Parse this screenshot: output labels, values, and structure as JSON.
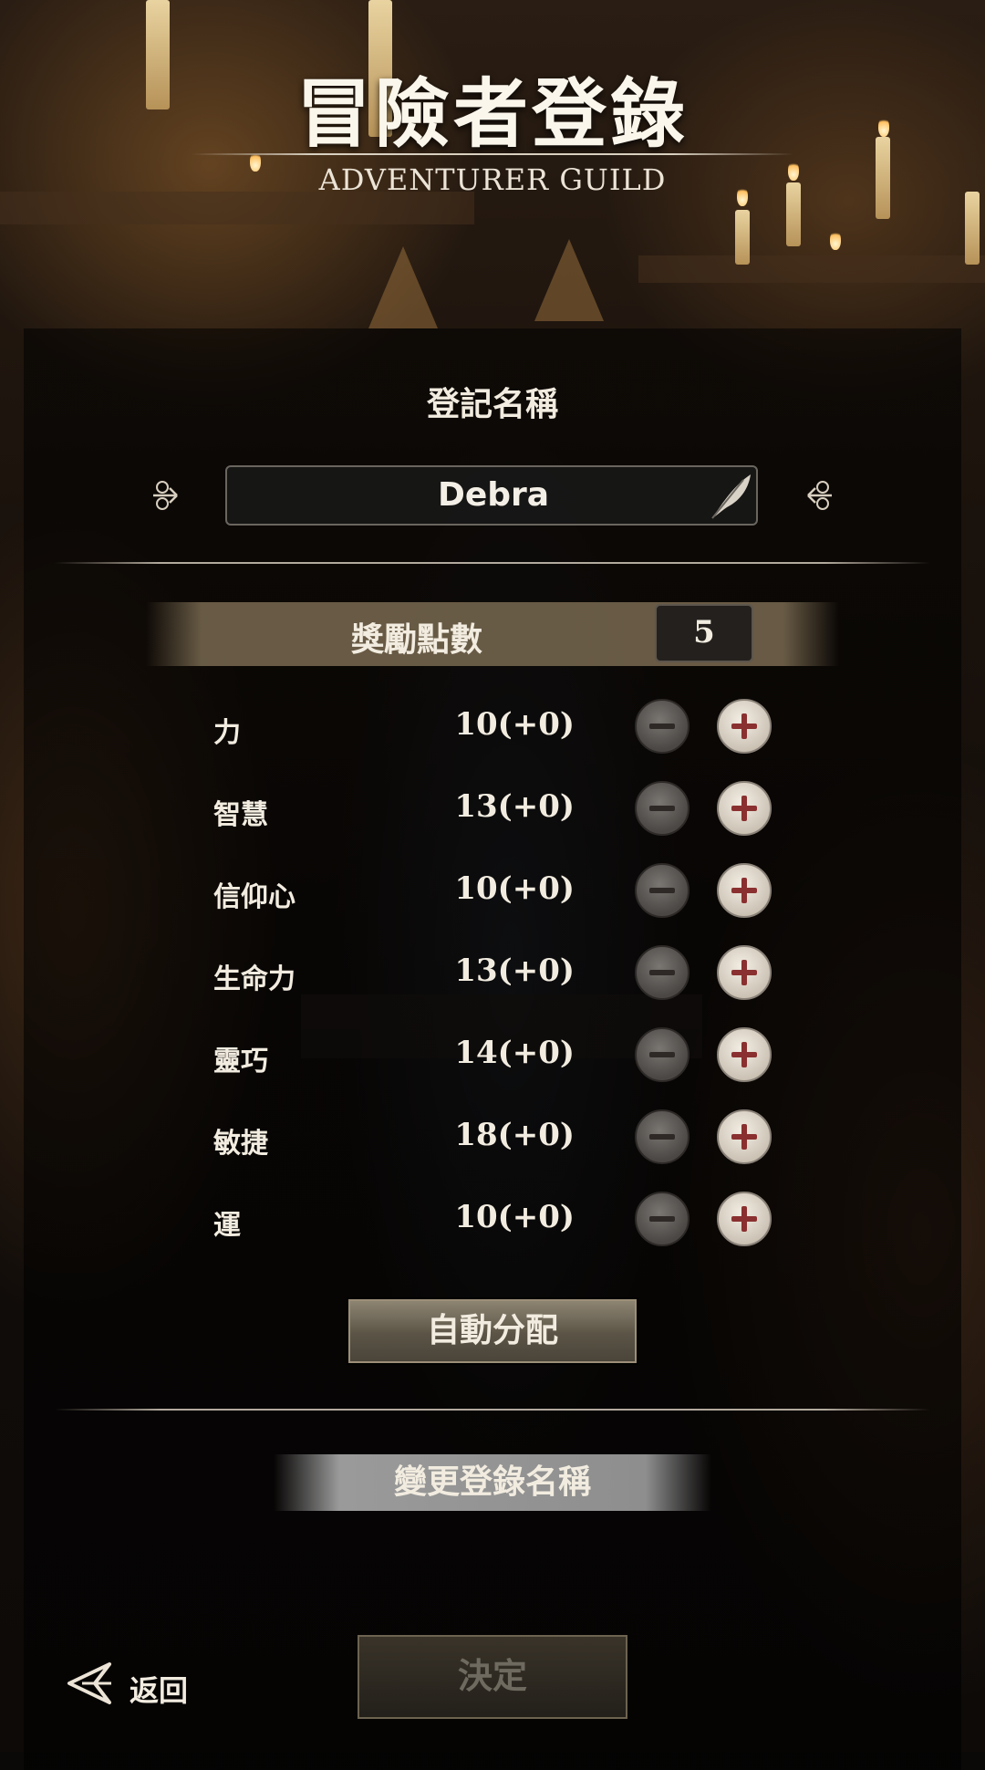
{
  "header": {
    "title": "冒險者登錄",
    "subtitle": "ADVENTURER GUILD"
  },
  "name_section": {
    "label": "登記名稱",
    "value": "Debra",
    "edit_icon": "quill-icon"
  },
  "bonus": {
    "label": "獎勵點數",
    "value": "5"
  },
  "stats": [
    {
      "name": "力",
      "value": "10(+0)"
    },
    {
      "name": "智慧",
      "value": "13(+0)"
    },
    {
      "name": "信仰心",
      "value": "10(+0)"
    },
    {
      "name": "生命力",
      "value": "13(+0)"
    },
    {
      "name": "靈巧",
      "value": "14(+0)"
    },
    {
      "name": "敏捷",
      "value": "18(+0)"
    },
    {
      "name": "運",
      "value": "10(+0)"
    }
  ],
  "buttons": {
    "auto_assign": "自動分配",
    "rename": "變更登錄名稱",
    "confirm": "決定",
    "back": "返回"
  },
  "colors": {
    "text": "#f2ece0",
    "bonus_band": "#786950",
    "plus_button": "#e8e1d6",
    "minus_button": "#5e5a56",
    "icon_glyph": "#8a3030"
  }
}
